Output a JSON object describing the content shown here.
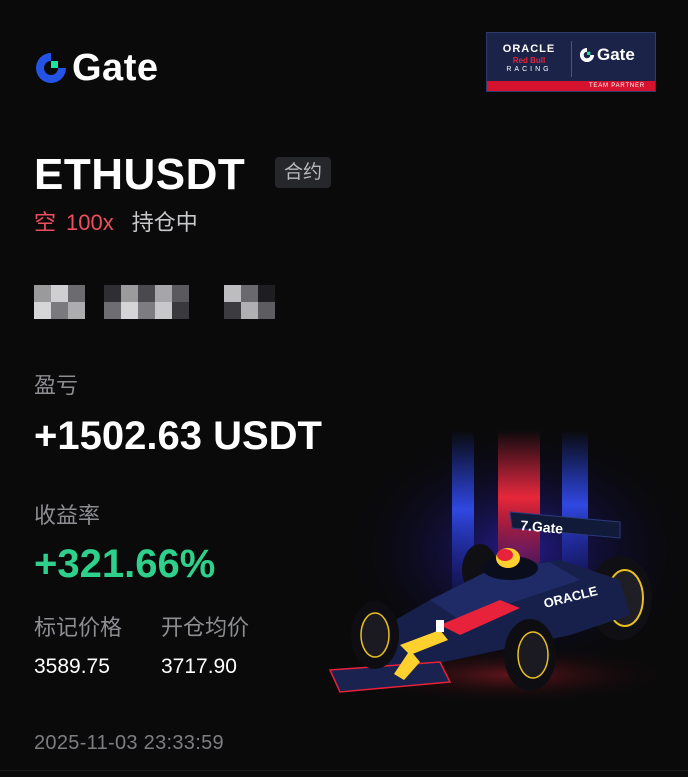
{
  "brand": {
    "name": "Gate"
  },
  "partner": {
    "oracle": "ORACLE",
    "redbull": "Red Bull",
    "racing": "RACING",
    "gate": "Gate",
    "team_partner": "TEAM PARTNER"
  },
  "position": {
    "symbol": "ETHUSDT",
    "type_tag": "合约",
    "side": "空",
    "leverage": "100x",
    "status": "持仓中"
  },
  "pnl": {
    "label": "盈亏",
    "value": "+1502.63 USDT"
  },
  "roi": {
    "label": "收益率",
    "value": "+321.66%"
  },
  "mark_price": {
    "label": "标记价格",
    "value": "3589.75"
  },
  "entry_price": {
    "label": "开仓均价",
    "value": "3717.90"
  },
  "timestamp": "2025-11-03 23:33:59",
  "colors": {
    "background": "#0a0a0b",
    "short": "#ee4d5e",
    "profit": "#2fd08b",
    "muted": "#8d8e92",
    "brand_blue": "#2354e6",
    "brand_green": "#17e6a1"
  }
}
